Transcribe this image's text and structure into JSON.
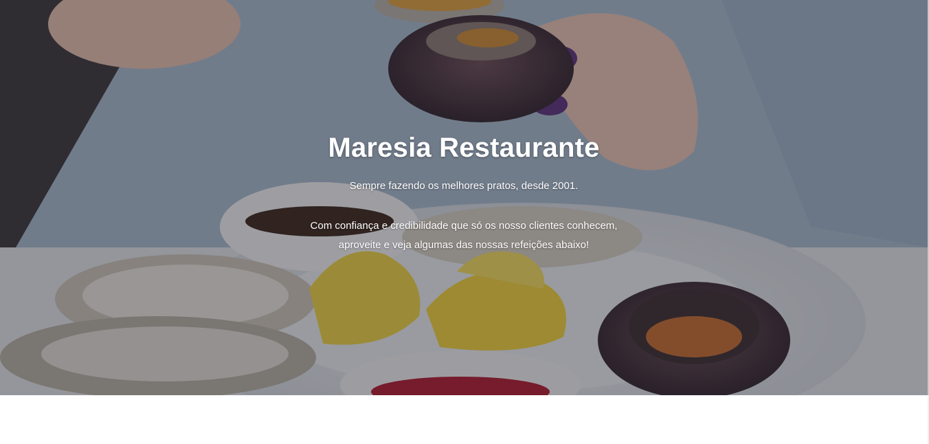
{
  "hero": {
    "title": "Maresia Restaurante",
    "tagline": "Sempre fazendo os melhores pratos, desde 2001.",
    "description_line1": "Com confiança e credibilidade que só os nosso clientes conhecem,",
    "description_line2": "aproveite e veja algumas das nossas refeições abaixo!",
    "background_image": "seafood-platter-photo"
  },
  "colors": {
    "overlay": "#23232d",
    "text": "#ffffff"
  }
}
